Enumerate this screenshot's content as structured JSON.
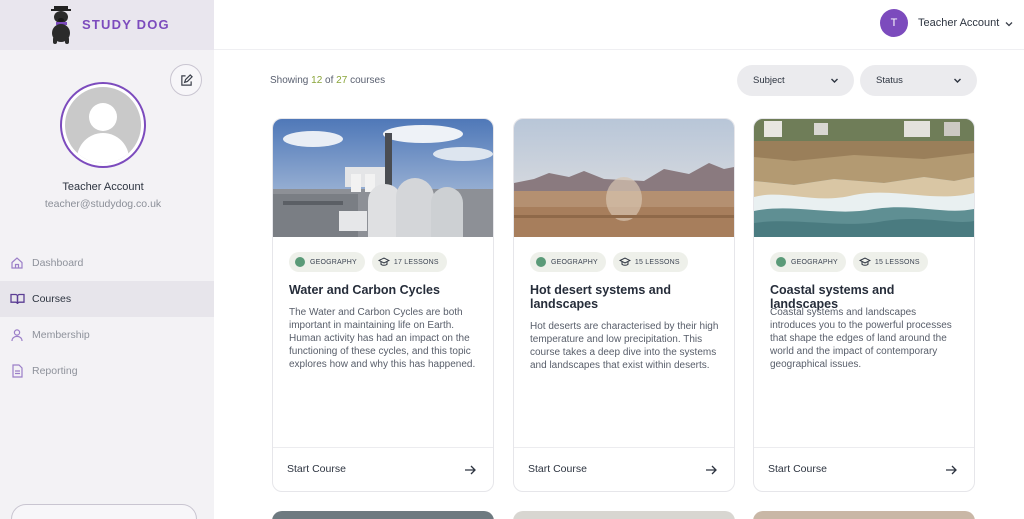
{
  "brand": {
    "name": "STUDY DOG",
    "logo_icon": "dog-logo-icon"
  },
  "sidebar": {
    "profile": {
      "name": "Teacher Account",
      "email": "teacher@studydog.co.uk"
    },
    "nav": [
      {
        "label": "Dashboard",
        "icon": "home-icon",
        "active": false
      },
      {
        "label": "Courses",
        "icon": "book-icon",
        "active": true
      },
      {
        "label": "Membership",
        "icon": "user-icon",
        "active": false
      },
      {
        "label": "Reporting",
        "icon": "document-icon",
        "active": false
      }
    ]
  },
  "header": {
    "user_initial": "T",
    "user_name": "Teacher Account"
  },
  "filters": {
    "showing_prefix": "Showing",
    "showing_count": "12",
    "showing_of": "of",
    "showing_total": "27",
    "showing_suffix": "courses",
    "subject_label": "Subject",
    "status_label": "Status"
  },
  "courses": [
    {
      "subject": "GEOGRAPHY",
      "lessons": "17 LESSONS",
      "title": "Water and Carbon Cycles",
      "description": "The Water and Carbon Cycles are both important in maintaining life on Earth. Human activity has had an impact on the functioning of these cycles, and this topic explores how and why this has happened.",
      "cta": "Start Course"
    },
    {
      "subject": "GEOGRAPHY",
      "lessons": "15 LESSONS",
      "title": "Hot desert systems and landscapes",
      "description": "Hot deserts are characterised by their high temperature and low precipitation. This course takes a deep dive into the systems and landscapes that exist within deserts.",
      "cta": "Start Course"
    },
    {
      "subject": "GEOGRAPHY",
      "lessons": "15 LESSONS",
      "title": "Coastal systems and landscapes",
      "description": "Coastal systems and landscapes introduces you to the powerful processes that shape the edges of land around the world and the impact of contemporary geographical issues.",
      "cta": "Start Course"
    }
  ],
  "colors": {
    "accent": "#7c4bbd",
    "count_highlight": "#8aa53a",
    "subject_dot": "#5a9a78"
  }
}
